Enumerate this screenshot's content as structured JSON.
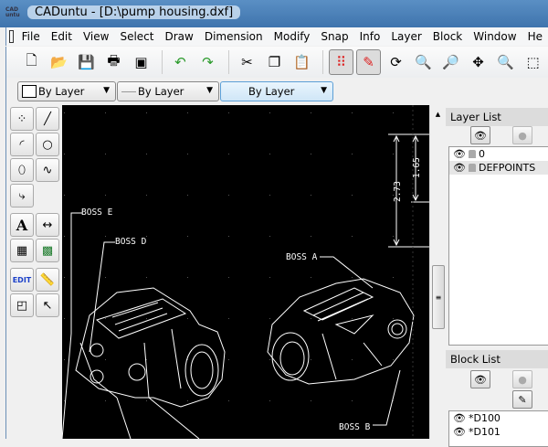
{
  "window": {
    "title": "CADuntu - [D:\\pump housing.dxf]",
    "logo": "CAD"
  },
  "menu": [
    "File",
    "Edit",
    "View",
    "Select",
    "Draw",
    "Dimension",
    "Modify",
    "Snap",
    "Info",
    "Layer",
    "Block",
    "Window",
    "He"
  ],
  "toolbar": [
    {
      "icon": "new-file",
      "g": "🗋"
    },
    {
      "icon": "open-folder",
      "g": "📂"
    },
    {
      "icon": "save",
      "g": "💾"
    },
    {
      "icon": "print",
      "g": "🖶"
    },
    {
      "icon": "print-preview",
      "g": "▣"
    },
    {
      "icon": "undo",
      "g": "↶"
    },
    {
      "icon": "redo",
      "g": "↷"
    },
    {
      "icon": "cut",
      "g": "✂"
    },
    {
      "icon": "copy",
      "g": "❐"
    },
    {
      "icon": "paste",
      "g": "📋"
    },
    {
      "icon": "grid",
      "g": "⠿"
    },
    {
      "icon": "draft-pen",
      "g": "✎"
    },
    {
      "icon": "redraw",
      "g": "⟳"
    },
    {
      "icon": "zoom-in",
      "g": "🔍"
    },
    {
      "icon": "zoom-out",
      "g": "🔎"
    },
    {
      "icon": "zoom-pan",
      "g": "✥"
    },
    {
      "icon": "zoom-auto",
      "g": "🔍"
    },
    {
      "icon": "zoom-window",
      "g": "⬚"
    }
  ],
  "props": {
    "color": "By Layer",
    "linetype": "By Layer",
    "linewidth": "By Layer"
  },
  "tools": [
    {
      "icon": "points",
      "g": "⁘"
    },
    {
      "icon": "line",
      "g": "╱"
    },
    {
      "icon": "arc",
      "g": "◜"
    },
    {
      "icon": "circle",
      "g": "○"
    },
    {
      "icon": "ellipse",
      "g": "⬯"
    },
    {
      "icon": "spline",
      "g": "∿"
    },
    {
      "icon": "polyline",
      "g": "⤷"
    },
    {
      "icon": "text",
      "g": "A"
    },
    {
      "icon": "dimension",
      "g": "↔"
    },
    {
      "icon": "hatch",
      "g": "▦"
    },
    {
      "icon": "image",
      "g": "▩"
    },
    {
      "icon": "edit",
      "g": "EDIT"
    },
    {
      "icon": "measure",
      "g": "📏"
    },
    {
      "icon": "select-modify",
      "g": "◰"
    },
    {
      "icon": "select-pointer",
      "g": "↖"
    }
  ],
  "drawing": {
    "labels": [
      "BOSS E",
      "BOSS D",
      "BOSS A",
      "BOSS B"
    ],
    "dims": [
      "2.73",
      "1.65"
    ]
  },
  "layer_list": {
    "title": "Layer List",
    "items": [
      "0",
      "DEFPOINTS"
    ]
  },
  "block_list": {
    "title": "Block List",
    "items": [
      "*D100",
      "*D101"
    ]
  }
}
